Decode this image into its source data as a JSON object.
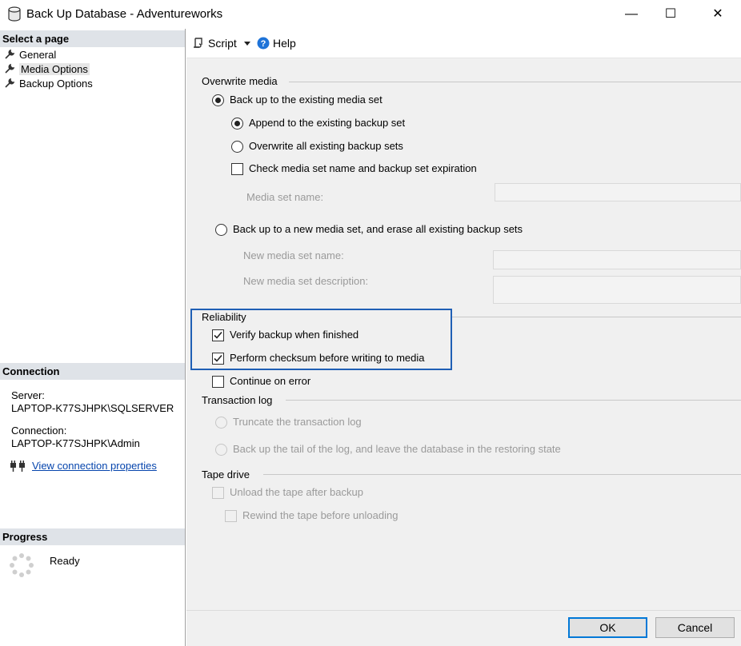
{
  "window": {
    "title": "Back Up Database - Adventureworks",
    "minimize_glyph": "—",
    "maximize_glyph": "☐",
    "close_glyph": "✕"
  },
  "sidebar": {
    "select_page_header": "Select a page",
    "pages": [
      {
        "label": "General",
        "selected": false
      },
      {
        "label": "Media Options",
        "selected": true
      },
      {
        "label": "Backup Options",
        "selected": false
      }
    ],
    "connection_header": "Connection",
    "server_label": "Server:",
    "server_value": "LAPTOP-K77SJHPK\\SQLSERVER",
    "connection_label": "Connection:",
    "connection_value": "LAPTOP-K77SJHPK\\Admin",
    "view_connection_link": "View connection properties",
    "progress_header": "Progress",
    "progress_status": "Ready"
  },
  "toolbar": {
    "script_label": "Script",
    "help_label": "Help"
  },
  "overwrite_media": {
    "group_label": "Overwrite media",
    "existing_media_set": {
      "label": "Back up to the existing media set",
      "selected": true
    },
    "append": {
      "label": "Append to the existing backup set",
      "selected": true
    },
    "overwrite_all": {
      "label": "Overwrite all existing backup sets",
      "selected": false
    },
    "check_media": {
      "label": "Check media set name and backup set expiration",
      "checked": false
    },
    "media_set_name_label": "Media set name:",
    "new_media_set": {
      "label": "Back up to a new media set, and erase all existing backup sets",
      "selected": false
    },
    "new_media_set_name_label": "New media set name:",
    "new_media_set_description_label": "New media set description:"
  },
  "reliability": {
    "group_label": "Reliability",
    "verify": {
      "label": "Verify backup when finished",
      "checked": true
    },
    "checksum": {
      "label": "Perform checksum before writing to media",
      "checked": true
    },
    "continue_on_error": {
      "label": "Continue on error",
      "checked": false
    }
  },
  "transaction_log": {
    "group_label": "Transaction log",
    "truncate": {
      "label": "Truncate the transaction log",
      "selected": false,
      "enabled": false
    },
    "tail": {
      "label": "Back up the tail of the log, and leave the database in the restoring state",
      "selected": false,
      "enabled": false
    }
  },
  "tape_drive": {
    "group_label": "Tape drive",
    "unload": {
      "label": "Unload the tape after backup",
      "checked": false,
      "enabled": false
    },
    "rewind": {
      "label": "Rewind the tape before unloading",
      "checked": false,
      "enabled": false
    }
  },
  "buttons": {
    "ok_label": "OK",
    "cancel_label": "Cancel"
  },
  "colors": {
    "highlight_border": "#1f5fb5",
    "link": "#0645ad",
    "section_header_bg": "#dfe3e8",
    "help_icon": "#1e73d8"
  },
  "icons": {
    "database": "database-icon",
    "wrench": "wrench-icon",
    "script": "script-icon",
    "dropdown": "chevron-down-icon",
    "help": "help-icon",
    "connection": "connection-plug-icon",
    "progress": "progress-spinner-icon"
  }
}
